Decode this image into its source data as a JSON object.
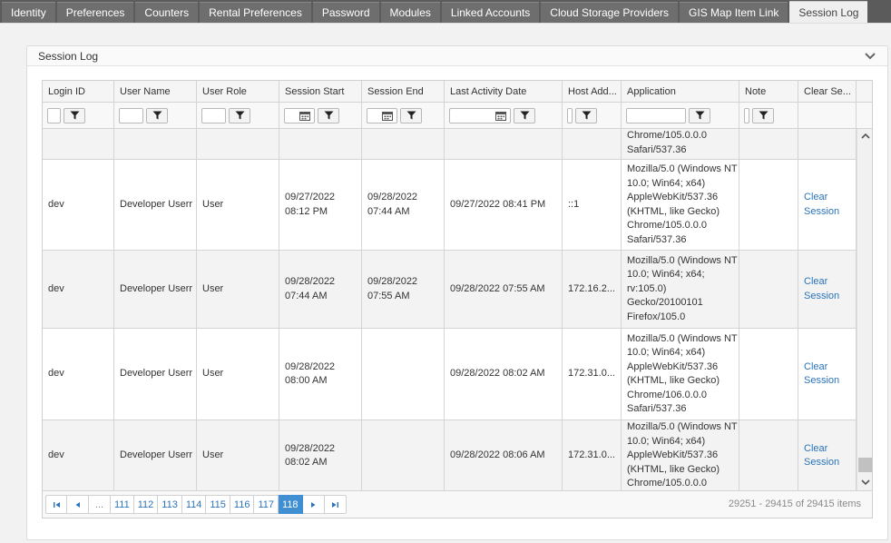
{
  "tabs": [
    {
      "label": "Identity",
      "active": false
    },
    {
      "label": "Preferences",
      "active": false
    },
    {
      "label": "Counters",
      "active": false
    },
    {
      "label": "Rental Preferences",
      "active": false
    },
    {
      "label": "Password",
      "active": false
    },
    {
      "label": "Modules",
      "active": false
    },
    {
      "label": "Linked Accounts",
      "active": false
    },
    {
      "label": "Cloud Storage Providers",
      "active": false
    },
    {
      "label": "GIS Map Item Link",
      "active": false
    },
    {
      "label": "Session Log",
      "active": true
    }
  ],
  "panel": {
    "title": "Session Log",
    "collapse_icon": "chevron-down-icon"
  },
  "grid": {
    "columns": [
      {
        "key": "login",
        "label": "Login ID"
      },
      {
        "key": "user",
        "label": "User Name"
      },
      {
        "key": "role",
        "label": "User Role"
      },
      {
        "key": "start",
        "label": "Session Start"
      },
      {
        "key": "end",
        "label": "Session End"
      },
      {
        "key": "activity",
        "label": "Last Activity Date"
      },
      {
        "key": "host",
        "label": "Host Add..."
      },
      {
        "key": "app",
        "label": "Application"
      },
      {
        "key": "note",
        "label": "Note"
      },
      {
        "key": "clear",
        "label": "Clear Se..."
      }
    ],
    "partial_row": {
      "application": [
        "Chrome/105.0.0.0",
        "Safari/537.36"
      ]
    },
    "rows": [
      {
        "login": "dev",
        "user": "Developer Userr",
        "role": "User",
        "start": [
          "09/27/2022",
          "08:12 PM"
        ],
        "end": [
          "09/28/2022",
          "07:44 AM"
        ],
        "activity": "09/27/2022 08:41 PM",
        "host": "::1",
        "app": [
          "Mozilla/5.0 (Windows NT",
          "10.0; Win64; x64)",
          "AppleWebKit/537.36",
          "(KHTML, like Gecko)",
          "Chrome/105.0.0.0",
          "Safari/537.36"
        ],
        "note": "",
        "clear": [
          "Clear",
          "Session"
        ]
      },
      {
        "login": "dev",
        "user": "Developer Userr",
        "role": "User",
        "start": [
          "09/28/2022",
          "07:44 AM"
        ],
        "end": [
          "09/28/2022",
          "07:55 AM"
        ],
        "activity": "09/28/2022 07:55 AM",
        "host": "172.16.2...",
        "app": [
          "Mozilla/5.0 (Windows NT",
          "10.0; Win64; x64;",
          "rv:105.0)",
          "Gecko/20100101",
          "Firefox/105.0"
        ],
        "note": "",
        "clear": [
          "Clear",
          "Session"
        ]
      },
      {
        "login": "dev",
        "user": "Developer Userr",
        "role": "User",
        "start": [
          "09/28/2022",
          "08:00 AM"
        ],
        "end": [],
        "activity": "09/28/2022 08:02 AM",
        "host": "172.31.0...",
        "app": [
          "Mozilla/5.0 (Windows NT",
          "10.0; Win64; x64)",
          "AppleWebKit/537.36",
          "(KHTML, like Gecko)",
          "Chrome/106.0.0.0",
          "Safari/537.36"
        ],
        "note": "",
        "clear": [
          "Clear",
          "Session"
        ]
      },
      {
        "login": "dev",
        "user": "Developer Userr",
        "role": "User",
        "start": [
          "09/28/2022",
          "08:02 AM"
        ],
        "end": [],
        "activity": "09/28/2022 08:06 AM",
        "host": "172.31.0...",
        "app": [
          "Mozilla/5.0 (Windows NT",
          "10.0; Win64; x64)",
          "AppleWebKit/537.36",
          "(KHTML, like Gecko)",
          "Chrome/105.0.0.0"
        ],
        "note": "",
        "clear": [
          "Clear",
          "Session"
        ]
      }
    ]
  },
  "pager": {
    "pages": [
      "...",
      "111",
      "112",
      "113",
      "114",
      "115",
      "116",
      "117",
      "118"
    ],
    "current": "118",
    "info": "29251 - 29415 of 29415 items"
  },
  "colors": {
    "link": "#2a74b9",
    "current_page": "#3f8fd2",
    "tabbar": "#5b5b5b"
  }
}
